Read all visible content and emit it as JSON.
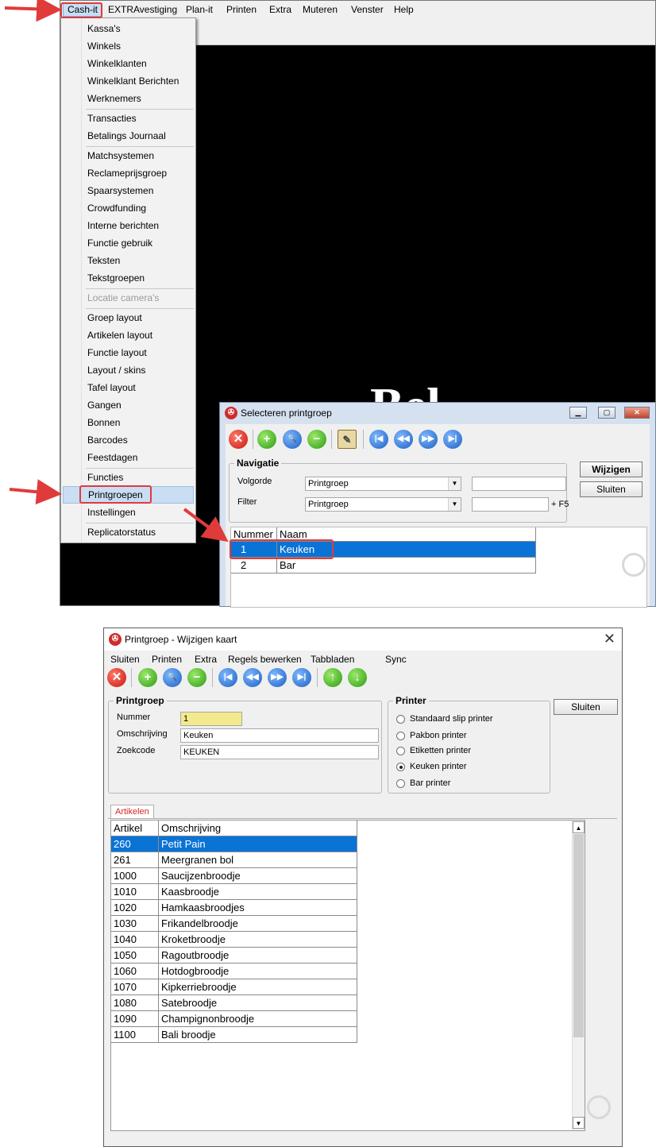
{
  "menubar": {
    "items": [
      "Cash-it",
      "EXTRAvestiging",
      "Plan-it",
      "Printen",
      "Extra",
      "Muteren",
      "Venster",
      "Help"
    ]
  },
  "cashit_menu": {
    "items": [
      "Kassa's",
      "Winkels",
      "Winkelklanten",
      "Winkelklant Berichten",
      "Werknemers",
      "Transacties",
      "Betalings Journaal",
      "Matchsystemen",
      "Reclameprijsgroep",
      "Spaarsystemen",
      "Crowdfunding",
      "Interne berichten",
      "Functie gebruik",
      "Teksten",
      "Tekstgroepen",
      "Locatie camera's",
      "Groep layout",
      "Artikelen layout",
      "Functie layout",
      "Layout / skins",
      "Tafel layout",
      "Gangen",
      "Bonnen",
      "Barcodes",
      "Feestdagen",
      "Functies",
      "Printgroepen",
      "Instellingen",
      "Replicatorstatus"
    ]
  },
  "background_text": "Bel",
  "select_window": {
    "title": "Selecteren printgroep",
    "group_label": "Navigatie",
    "volgorde_label": "Volgorde",
    "volgorde_value": "Printgroep",
    "filter_label": "Filter",
    "filter_value": "Printgroep",
    "filter_hint": "+ F5",
    "wijzigen": "Wijzigen",
    "sluiten": "Sluiten",
    "columns": [
      "Nummer",
      "Naam"
    ],
    "rows": [
      {
        "nummer": "1",
        "naam": "Keuken"
      },
      {
        "nummer": "2",
        "naam": "Bar"
      }
    ]
  },
  "edit_window": {
    "title": "Printgroep - Wijzigen kaart",
    "menu": [
      "Sluiten",
      "Printen",
      "Extra",
      "Regels bewerken",
      "Tabbladen",
      "Sync"
    ],
    "printgroep_label": "Printgroep",
    "nummer_label": "Nummer",
    "nummer_value": "1",
    "omschrijving_label": "Omschrijving",
    "omschrijving_value": "Keuken",
    "zoekcode_label": "Zoekcode",
    "zoekcode_value": "KEUKEN",
    "printer_label": "Printer",
    "printer_options": [
      "Standaard slip printer",
      "Pakbon printer",
      "Etiketten printer",
      "Keuken printer",
      "Bar printer"
    ],
    "printer_selected": "Keuken printer",
    "sluiten": "Sluiten",
    "tab": "Artikelen",
    "columns": [
      "Artikel",
      "Omschrijving"
    ],
    "rows": [
      {
        "artikel": "260",
        "omschrijving": "Petit Pain"
      },
      {
        "artikel": "261",
        "omschrijving": "Meergranen bol"
      },
      {
        "artikel": "1000",
        "omschrijving": "Saucijzenbroodje"
      },
      {
        "artikel": "1010",
        "omschrijving": "Kaasbroodje"
      },
      {
        "artikel": "1020",
        "omschrijving": "Hamkaasbroodjes"
      },
      {
        "artikel": "1030",
        "omschrijving": "Frikandelbroodje"
      },
      {
        "artikel": "1040",
        "omschrijving": "Kroketbroodje"
      },
      {
        "artikel": "1050",
        "omschrijving": "Ragoutbroodje"
      },
      {
        "artikel": "1060",
        "omschrijving": "Hotdogbroodje"
      },
      {
        "artikel": "1070",
        "omschrijving": "Kipkerriebroodje"
      },
      {
        "artikel": "1080",
        "omschrijving": "Satebroodje"
      },
      {
        "artikel": "1090",
        "omschrijving": "Champignonbroodje"
      },
      {
        "artikel": "1100",
        "omschrijving": "Bali broodje"
      }
    ]
  },
  "colors": {
    "selection": "#0a73d6",
    "highlight_box": "#e03b3b",
    "menu_highlight": "#c9ddf3"
  }
}
